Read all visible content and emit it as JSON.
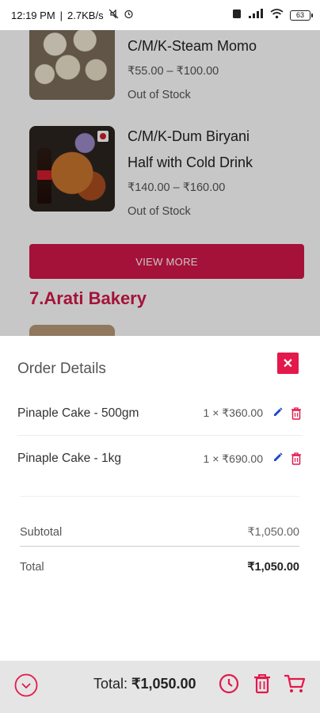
{
  "status_bar": {
    "time": "12:19 PM",
    "speed": "2.7KB/s",
    "network": "4G",
    "battery": "63"
  },
  "products": [
    {
      "name": "C/M/K-Steam Momo",
      "price": "₹55.00 – ₹100.00",
      "stock": "Out of Stock"
    },
    {
      "name_line1": "C/M/K-Dum Biryani",
      "name_line2": "Half with Cold Drink",
      "price": "₹140.00 – ₹160.00",
      "stock": "Out of Stock"
    }
  ],
  "view_more_label": "VIEW MORE",
  "section_title": "7.Arati Bakery",
  "order": {
    "title": "Order Details",
    "items": [
      {
        "name": "Pinaple Cake - 500gm",
        "qty": "1 ×",
        "price": "₹360.00"
      },
      {
        "name": "Pinaple Cake - 1kg",
        "qty": "1 ×",
        "price": "₹690.00"
      }
    ],
    "subtotal_label": "Subtotal",
    "subtotal_value": "₹1,050.00",
    "total_label": "Total",
    "total_value": "₹1,050.00"
  },
  "bottom_bar": {
    "total_label": "Total:",
    "total_value": "₹1,050.00"
  },
  "colors": {
    "accent": "#d4184a",
    "close": "#e3194b",
    "edit": "#1a44c9",
    "bar": "#e5e5e5"
  }
}
